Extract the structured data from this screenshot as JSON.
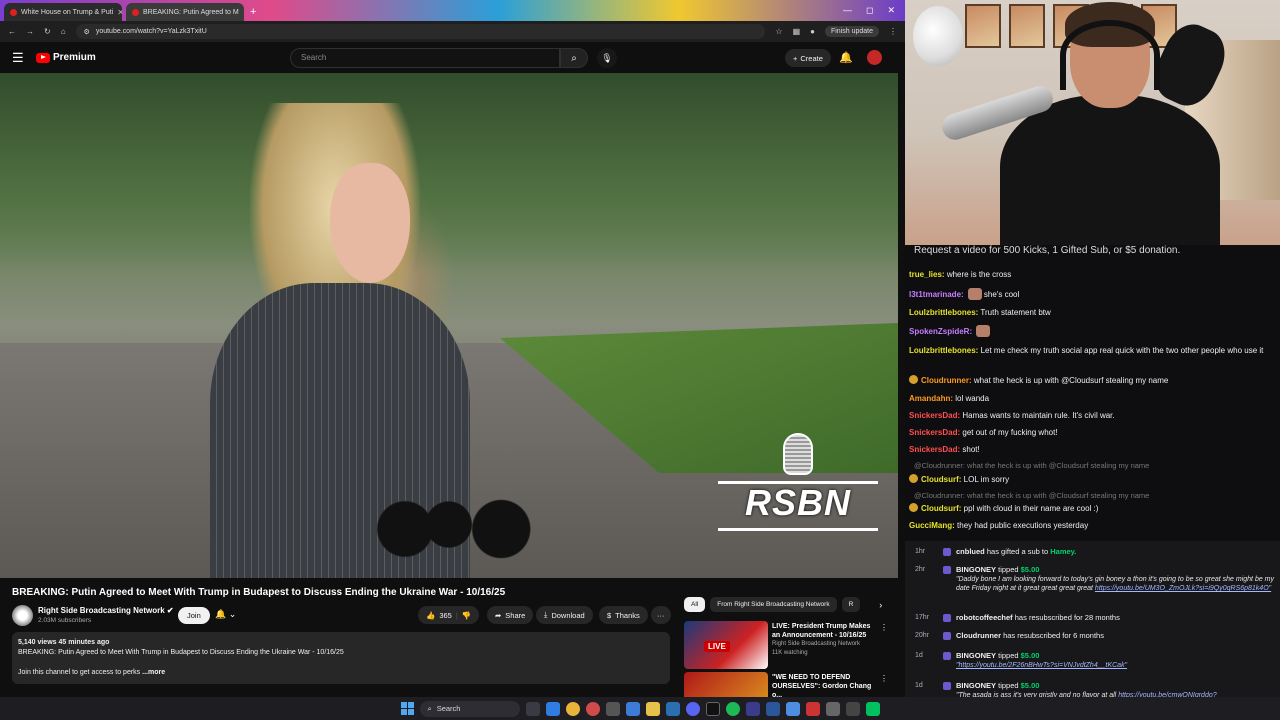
{
  "browser": {
    "tabs": [
      {
        "label": "White House on Trump & Puti",
        "active": false
      },
      {
        "label": "BREAKING: Putin Agreed to M",
        "active": true
      }
    ],
    "new_tab": "+",
    "window_controls": [
      "—",
      "◻",
      "✕"
    ],
    "url": "youtube.com/watch?v=YaLzk3TxitU",
    "finish_update": "Finish update"
  },
  "youtube": {
    "logo": "Premium",
    "search_placeholder": "Search",
    "create_label": "Create",
    "video_title": "BREAKING: Putin Agreed to Meet With Trump in Budapest to Discuss Ending the Ukraine War - 10/16/25",
    "channel_name": "Right Side Broadcasting Network",
    "subscribers": "2.03M subscribers",
    "join_label": "Join",
    "like_count": "365",
    "share_label": "Share",
    "download_label": "Download",
    "thanks_label": "Thanks",
    "more_actions": "···",
    "description": {
      "meta": "5,140 views  45 minutes ago",
      "line1": "BREAKING: Putin Agreed to Meet With Trump in Budapest to Discuss Ending the Ukraine War - 10/16/25",
      "line2": "Join this channel to get access to perks",
      "more": "...more"
    },
    "watermark": "RSBN",
    "chips": [
      "All",
      "From Right Side Broadcasting Network",
      "R"
    ],
    "related": [
      {
        "title": "LIVE: President Trump Makes an Announcement - 10/16/25",
        "channel": "Right Side Broadcasting Network",
        "meta": "11K watching",
        "badge": "LIVE"
      },
      {
        "title": "\"WE NEED TO DEFEND OURSELVES\": Gordon Chang o...",
        "channel": "",
        "meta": "",
        "badge": ""
      }
    ]
  },
  "chat": {
    "banner": "Request a video for 500 Kicks, 1 Gifted Sub, or $5 donation.",
    "colors": {
      "green": "#00d26a",
      "purple": "#c77dff",
      "red": "#ff4f4f",
      "orange": "#ff9a1f",
      "yellow": "#e6e22b",
      "blue": "#5aa9ff"
    },
    "messages": [
      {
        "user": "true_lies:",
        "text": "where is the cross",
        "color": "#e6e22b"
      },
      {
        "user": "l3t1tmarinade:",
        "text": "she's cool",
        "color": "#c77dff"
      },
      {
        "user": "Loulzbrittlebones:",
        "text": "Truth statement btw",
        "color": "#e6e22b"
      },
      {
        "user": "SpokenZspideR:",
        "text": "",
        "color": "#c77dff"
      },
      {
        "user": "Loulzbrittlebones:",
        "text": "Let me check my truth social app real quick with the two other people who use it",
        "color": "#e6e22b"
      },
      {
        "user": "Cloudrunner:",
        "text": "what the heck is up with @Cloudsurf stealing my name",
        "color": "#ff9a1f"
      },
      {
        "user": "Amandahn:",
        "text": "lol wanda",
        "color": "#ff9a1f"
      },
      {
        "user": "SnickersDad:",
        "text": "Hamas wants to maintain rule. It's civil war.",
        "color": "#ff4f4f"
      },
      {
        "user": "SnickersDad:",
        "text": "get out of my fucking whot!",
        "color": "#ff4f4f"
      },
      {
        "user": "SnickersDad:",
        "text": "shot!",
        "color": "#ff4f4f"
      },
      {
        "user": "",
        "text": "@Cloudrunner: what the heck is up with @Cloudsurf stealing my name",
        "color": "#777777"
      },
      {
        "user": "Cloudsurf:",
        "text": "LOL im sorry",
        "color": "#e6e22b"
      },
      {
        "user": "",
        "text": "@Cloudrunner: what the heck is up with @Cloudsurf stealing my name",
        "color": "#777777"
      },
      {
        "user": "Cloudsurf:",
        "text": "ppl with cloud in their name are cool :)",
        "color": "#e6e22b"
      },
      {
        "user": "GucciMang:",
        "text": "they had public executions yesterday",
        "color": "#e6e22b"
      }
    ],
    "events": [
      {
        "ago": "1hr",
        "user": "cnblued",
        "text": "has gifted a sub to",
        "target": "Hamey.",
        "msg": "",
        "link": ""
      },
      {
        "ago": "2hr",
        "user": "BINGONEY",
        "text": "tipped",
        "target": "$5.00",
        "msg": "\"Daddy bone I am looking forward to today's gin boney a thon it's going to be so great she might be my date Friday night at it great great great great",
        "link": "https://youtu.be/UM3O_ZmOJLk?si=i9Qy0qRS6p81k4O\""
      },
      {
        "ago": "17hr",
        "user": "robotcoffeechef",
        "text": "has resubscribed for 28 months",
        "target": "",
        "msg": "",
        "link": ""
      },
      {
        "ago": "20hr",
        "user": "Cloudrunner",
        "text": "has resubscribed for 6 months",
        "target": "",
        "msg": "",
        "link": ""
      },
      {
        "ago": "1d",
        "user": "BINGONEY",
        "text": "tipped",
        "target": "$5.00",
        "msg": "",
        "link": "\"https://youtu.be/2F26nBHwTs?si=VNJvdtZh4__tKCak\""
      },
      {
        "ago": "1d",
        "user": "BINGONEY",
        "text": "tipped",
        "target": "$5.00",
        "msg": "\"The asada is ass it's very gristly and no flavor at all",
        "link": "https://youtu.be/cmwQNIgrddo?si=4Ofg9UpltL0EWHRV\""
      }
    ]
  },
  "taskbar": {
    "search_label": "Search"
  }
}
